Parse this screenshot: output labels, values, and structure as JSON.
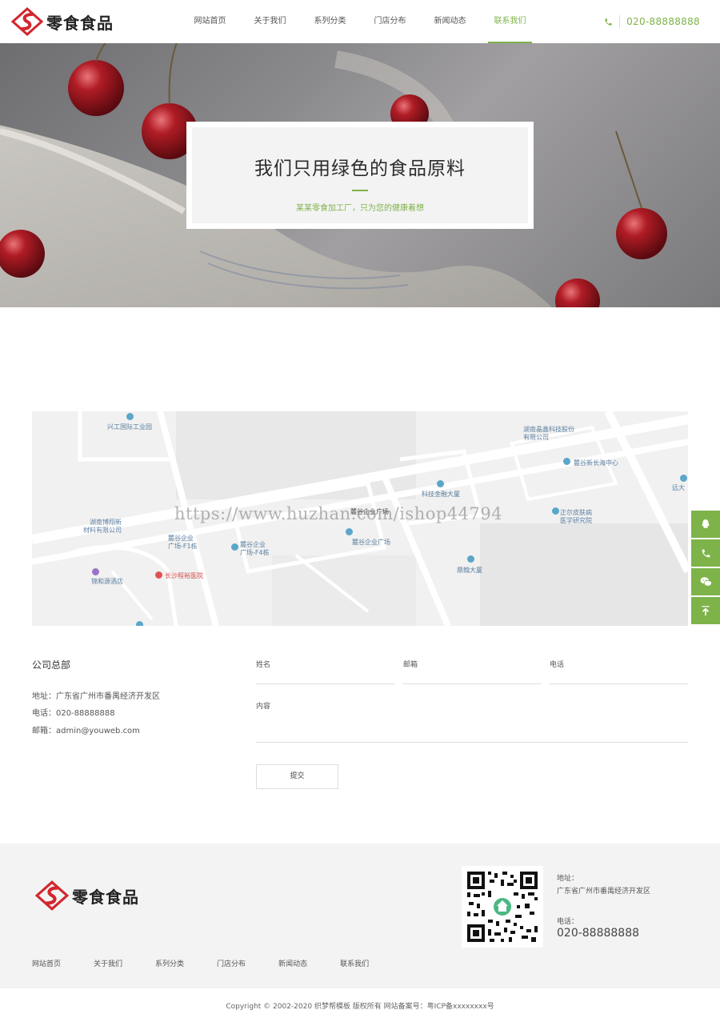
{
  "brand": {
    "name": "零食食品",
    "accent_color": "#7eb34a",
    "logo_red": "#d3262e"
  },
  "nav": {
    "items": [
      {
        "label": "网站首页"
      },
      {
        "label": "关于我们"
      },
      {
        "label": "系列分类"
      },
      {
        "label": "门店分布"
      },
      {
        "label": "新闻动态"
      },
      {
        "label": "联系我们"
      }
    ],
    "active_index": 5
  },
  "header": {
    "phone_icon": "phone-icon",
    "phone": "020-88888888"
  },
  "banner": {
    "title": "我们只用绿色的食品原料",
    "subtitle": "某某零食加工厂，只为您的健康着想"
  },
  "map": {
    "labels": [
      {
        "text": "兴工国际工业园",
        "kind": "poi"
      },
      {
        "text": "湖南晶鑫科技股份",
        "kind": "text"
      },
      {
        "text": "有限公司",
        "kind": "text"
      },
      {
        "text": "麓谷新长海中心",
        "kind": "poi"
      },
      {
        "text": "远大",
        "kind": "poi"
      },
      {
        "text": "科技金融大厦",
        "kind": "poi"
      },
      {
        "text": "麓谷企业广场",
        "kind": "text"
      },
      {
        "text": "正尔皮肤病",
        "kind": "poi"
      },
      {
        "text": "医学研究院",
        "kind": "text"
      },
      {
        "text": "湖南博翔新",
        "kind": "text"
      },
      {
        "text": "材料有限公司",
        "kind": "text"
      },
      {
        "text": "麓谷企业",
        "kind": "text"
      },
      {
        "text": "广场-F1栋",
        "kind": "text"
      },
      {
        "text": "麓谷企业",
        "kind": "poi"
      },
      {
        "text": "广场-F4栋",
        "kind": "text"
      },
      {
        "text": "麓谷企业广场",
        "kind": "poi"
      },
      {
        "text": "鼎翰大厦",
        "kind": "poi"
      },
      {
        "text": "锦和源酒店",
        "kind": "poi"
      },
      {
        "text": "长沙程裕医院",
        "kind": "hospital"
      }
    ],
    "watermark": "https://www.huzhan.com/ishop44794"
  },
  "side_float": {
    "icons": [
      "qq-icon",
      "phone-icon",
      "wechat-icon",
      "back-to-top-icon"
    ]
  },
  "contact": {
    "hq_title": "公司总部",
    "address": "地址：广东省广州市番禺经济开发区",
    "phone": "电话：020-88888888",
    "email": "邮箱：admin@youweb.com"
  },
  "form": {
    "name_label": "姓名",
    "email_label": "邮箱",
    "phone_label": "电话",
    "content_label": "内容",
    "submit_label": "提交"
  },
  "footer": {
    "brand": "零食食品",
    "qr_icon": "qr-code-icon",
    "address_key": "地址：",
    "address_value": "广东省广州市番禺经济开发区",
    "tel_key": "电话：",
    "tel_value": "020-88888888",
    "nav": [
      "网站首页",
      "关于我们",
      "系列分类",
      "门店分布",
      "新闻动态",
      "联系我们"
    ],
    "copyright": "Copyright © 2002-2020 织梦帮模板 版权所有 网站备案号：粤ICP备xxxxxxxx号"
  }
}
